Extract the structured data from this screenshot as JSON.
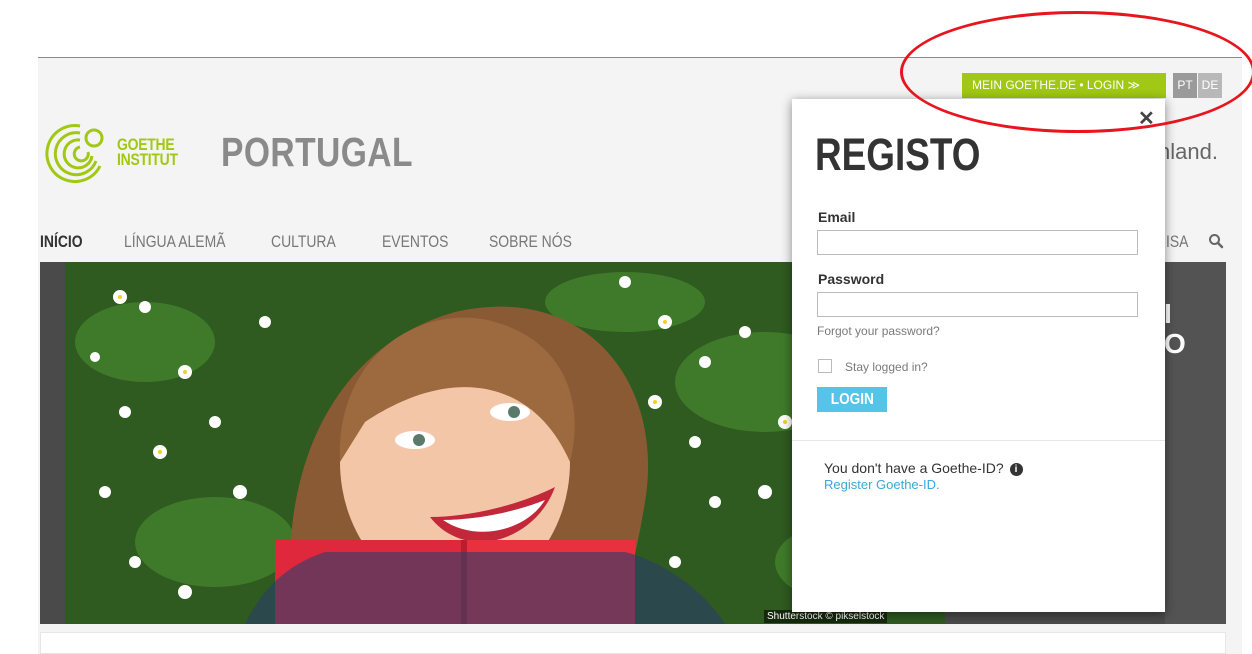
{
  "topbar": {
    "login_label": "MEIN GOETHE.DE • LOGIN ≫",
    "lang_pt": "PT",
    "lang_de": "DE"
  },
  "header": {
    "brand_line1": "GOETHE",
    "brand_line2": "INSTITUT",
    "country": "PORTUGAL",
    "tagline_fragment": "hland."
  },
  "nav": {
    "items": [
      {
        "label": "INÍCIO",
        "active": true
      },
      {
        "label": "LÍNGUA ALEMÃ",
        "active": false
      },
      {
        "label": "CULTURA",
        "active": false
      },
      {
        "label": "EVENTOS",
        "active": false
      },
      {
        "label": "SOBRE NÓS",
        "active": false
      }
    ],
    "right_fragment": "ISA"
  },
  "hero": {
    "credit": "Shutterstock © pikselstock",
    "side_fragment_1": "I",
    "side_fragment_2": "O"
  },
  "login_modal": {
    "title": "REGISTO",
    "email_label": "Email",
    "email_value": "",
    "password_label": "Password",
    "password_value": "",
    "forgot_link": "Forgot your password?",
    "stay_logged_in": "Stay logged in?",
    "stay_checked": false,
    "login_button": "LOGIN",
    "no_id_text": "You don't have a Goethe-ID?",
    "register_link": "Register Goethe-ID.",
    "close_symbol": "✕"
  },
  "colors": {
    "brand_green": "#a0c814",
    "login_blue": "#55c4e8",
    "link_blue": "#3aa9d6",
    "annotation_red": "#e8141e"
  }
}
